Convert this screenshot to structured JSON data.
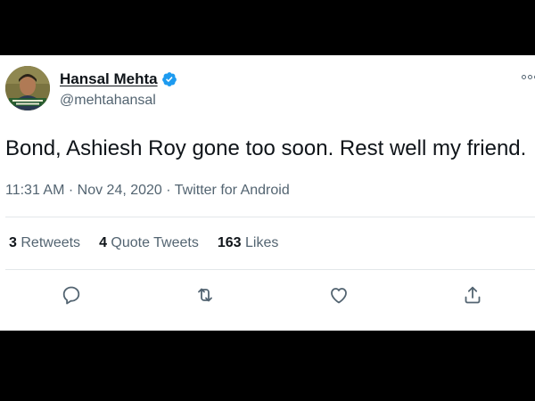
{
  "tweet": {
    "author": {
      "display_name": "Hansal Mehta",
      "handle": "@mehtahansal",
      "verified": true
    },
    "text": "Bond, Ashiesh Roy gone too soon. Rest well my friend.",
    "meta": {
      "time": "11:31 AM",
      "separator": " · ",
      "date": "Nov 24, 2020",
      "source": "Twitter for Android"
    },
    "stats": {
      "retweets_count": "3",
      "retweets_label": "Retweets",
      "quote_count": "4",
      "quote_label": "Quote Tweets",
      "likes_count": "163",
      "likes_label": "Likes"
    }
  },
  "icons": {
    "verified": "verified-badge-icon",
    "more": "more-options-icon",
    "reply": "reply-icon",
    "retweet": "retweet-icon",
    "like": "heart-icon",
    "share": "share-icon"
  },
  "colors": {
    "verified_blue": "#1d9bf0",
    "secondary_text": "#536471",
    "primary_text": "#0f1419"
  }
}
